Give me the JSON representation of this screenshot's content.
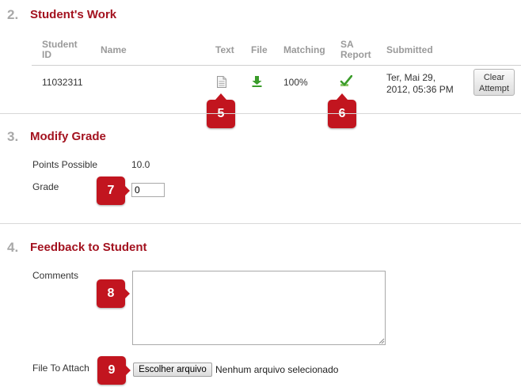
{
  "sections": {
    "students_work": {
      "number": "2.",
      "title": "Student's Work"
    },
    "modify_grade": {
      "number": "3.",
      "title": "Modify Grade"
    },
    "feedback": {
      "number": "4.",
      "title": "Feedback to Student"
    }
  },
  "table": {
    "headers": {
      "student_id_1": "Student",
      "student_id_2": "ID",
      "name": "Name",
      "text": "Text",
      "file": "File",
      "matching": "Matching",
      "sa_report_1": "SA",
      "sa_report_2": "Report",
      "submitted": "Submitted"
    },
    "row": {
      "student_id": "11032311",
      "name": "",
      "matching": "100%",
      "submitted_1": "Ter, Mai 29,",
      "submitted_2": "2012, 05:36 PM",
      "clear_1": "Clear",
      "clear_2": "Attempt",
      "icons": {
        "text": "document-icon",
        "file": "download-icon",
        "sa_report": "check-report-icon"
      }
    }
  },
  "grade": {
    "points_label": "Points Possible",
    "points_value": "10.0",
    "grade_label": "Grade",
    "grade_value": "0"
  },
  "feedback": {
    "comments_label": "Comments",
    "comments_value": "",
    "file_label": "File To Attach",
    "file_button": "Escolher arquivo",
    "file_status": "Nenhum arquivo selecionado"
  },
  "callouts": {
    "c5": "5",
    "c6": "6",
    "c7": "7",
    "c8": "8",
    "c9": "9"
  },
  "colors": {
    "accent": "#a3121f",
    "callout": "#c2151f",
    "icon_green": "#3a9c2a"
  }
}
